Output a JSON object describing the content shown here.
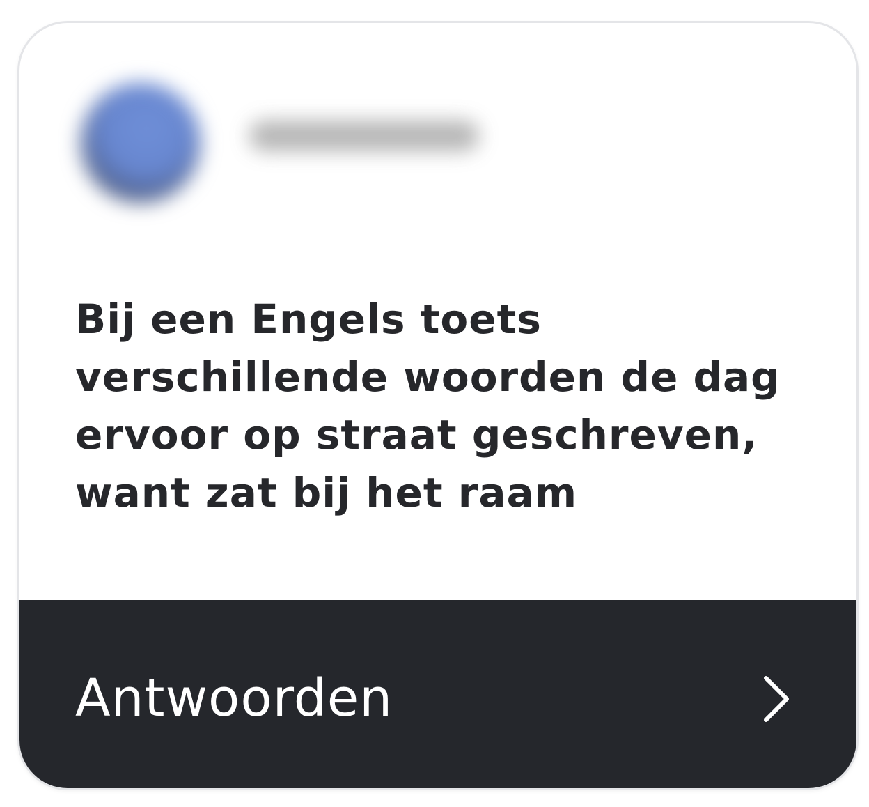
{
  "post": {
    "avatar_icon": "blurred-avatar",
    "author_name_hidden": true,
    "message": "Bij een Engels toets verschillende woorden de dag ervoor op straat geschreven, want zat bij het raam"
  },
  "reply": {
    "label": "Antwoorden",
    "icon": "chevron-right-icon"
  },
  "colors": {
    "card_background": "#ffffff",
    "card_border": "#e4e5e8",
    "message_text": "#26272b",
    "reply_background": "#25272c",
    "reply_text": "#ffffff"
  }
}
